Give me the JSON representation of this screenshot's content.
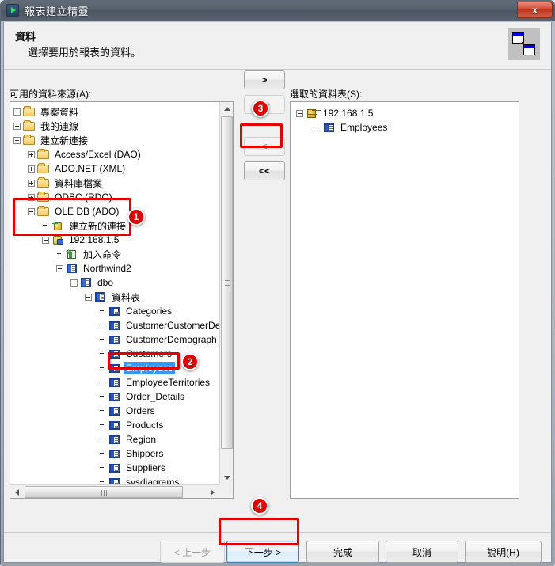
{
  "window": {
    "title": "報表建立精靈",
    "close_label": "x",
    "app_icon": "wizard-arrow-icon"
  },
  "header": {
    "title": "資料",
    "subtitle": "選擇要用於報表的資料。",
    "icon": "data-connection-icon"
  },
  "left_panel": {
    "label": "可用的資料來源(A):",
    "nodes": [
      {
        "label": "專案資料",
        "indent": 0,
        "state": "plus",
        "icon": "folder-icon"
      },
      {
        "label": "我的連線",
        "indent": 0,
        "state": "plus",
        "icon": "folder-icon"
      },
      {
        "label": "建立新連接",
        "indent": 0,
        "state": "minus",
        "icon": "folder-icon"
      },
      {
        "label": "Access/Excel (DAO)",
        "indent": 1,
        "state": "plus",
        "icon": "folder-icon"
      },
      {
        "label": "ADO.NET (XML)",
        "indent": 1,
        "state": "plus",
        "icon": "folder-icon"
      },
      {
        "label": "資料庫檔案",
        "indent": 1,
        "state": "plus",
        "icon": "folder-icon"
      },
      {
        "label": "ODBC (RDO)",
        "indent": 1,
        "state": "plus",
        "icon": "folder-icon"
      },
      {
        "label": "OLE DB (ADO)",
        "indent": 1,
        "state": "minus",
        "icon": "folder-icon"
      },
      {
        "label": "建立新的連接",
        "indent": 2,
        "state": "none",
        "icon": "new-connection-icon"
      },
      {
        "label": "192.168.1.5",
        "indent": 2,
        "state": "minus",
        "icon": "server-icon"
      },
      {
        "label": "加入命令",
        "indent": 3,
        "state": "none",
        "icon": "add-command-icon"
      },
      {
        "label": "Northwind2",
        "indent": 3,
        "state": "minus",
        "icon": "database-icon"
      },
      {
        "label": "dbo",
        "indent": 4,
        "state": "minus",
        "icon": "database-icon"
      },
      {
        "label": "資料表",
        "indent": 5,
        "state": "minus",
        "icon": "database-icon"
      },
      {
        "label": "Categories",
        "indent": 6,
        "state": "none",
        "icon": "table-icon"
      },
      {
        "label": "CustomerCustomerDe",
        "indent": 6,
        "state": "none",
        "icon": "table-icon"
      },
      {
        "label": "CustomerDemograph",
        "indent": 6,
        "state": "none",
        "icon": "table-icon"
      },
      {
        "label": "Customers",
        "indent": 6,
        "state": "none",
        "icon": "table-icon"
      },
      {
        "label": "Employees",
        "indent": 6,
        "state": "none",
        "icon": "table-icon",
        "selected": true
      },
      {
        "label": "EmployeeTerritories",
        "indent": 6,
        "state": "none",
        "icon": "table-icon"
      },
      {
        "label": "Order_Details",
        "indent": 6,
        "state": "none",
        "icon": "table-icon"
      },
      {
        "label": "Orders",
        "indent": 6,
        "state": "none",
        "icon": "table-icon"
      },
      {
        "label": "Products",
        "indent": 6,
        "state": "none",
        "icon": "table-icon"
      },
      {
        "label": "Region",
        "indent": 6,
        "state": "none",
        "icon": "table-icon"
      },
      {
        "label": "Shippers",
        "indent": 6,
        "state": "none",
        "icon": "table-icon"
      },
      {
        "label": "Suppliers",
        "indent": 6,
        "state": "none",
        "icon": "table-icon"
      },
      {
        "label": "sysdiagrams",
        "indent": 6,
        "state": "none",
        "icon": "table-icon"
      }
    ]
  },
  "right_panel": {
    "label": "選取的資料表(S):",
    "nodes": [
      {
        "label": "192.168.1.5",
        "indent": 0,
        "state": "minus",
        "icon": "cube-icon"
      },
      {
        "label": "Employees",
        "indent": 1,
        "state": "none",
        "icon": "table-icon"
      }
    ]
  },
  "transfer_buttons": [
    {
      "label": ">",
      "name": "move-right-button",
      "enabled": true,
      "highlighted": true
    },
    {
      "label": ">>",
      "name": "move-all-right-button",
      "enabled": false,
      "highlighted": false
    },
    {
      "label": "<",
      "name": "move-left-button",
      "enabled": false,
      "highlighted": false
    },
    {
      "label": "<<",
      "name": "move-all-left-button",
      "enabled": true,
      "highlighted": false
    }
  ],
  "footer_buttons": [
    {
      "label": "< 上一步",
      "name": "back-button",
      "enabled": false,
      "focused": false
    },
    {
      "label": "下一步 >",
      "name": "next-button",
      "enabled": true,
      "focused": true
    },
    {
      "label": "完成",
      "name": "finish-button",
      "enabled": true,
      "focused": false
    },
    {
      "label": "取消",
      "name": "cancel-button",
      "enabled": true,
      "focused": false
    },
    {
      "label": "說明(H)",
      "name": "help-button",
      "enabled": true,
      "focused": false
    }
  ],
  "annotations": [
    {
      "number": "1",
      "target": "ole-db-ado-group"
    },
    {
      "number": "2",
      "target": "employees-table-node"
    },
    {
      "number": "3",
      "target": "move-right-button"
    },
    {
      "number": "4",
      "target": "next-button"
    }
  ],
  "colors": {
    "annotation_red": "#e50000",
    "selection_blue": "#3399ff",
    "focus_border": "#3c7fb1"
  }
}
